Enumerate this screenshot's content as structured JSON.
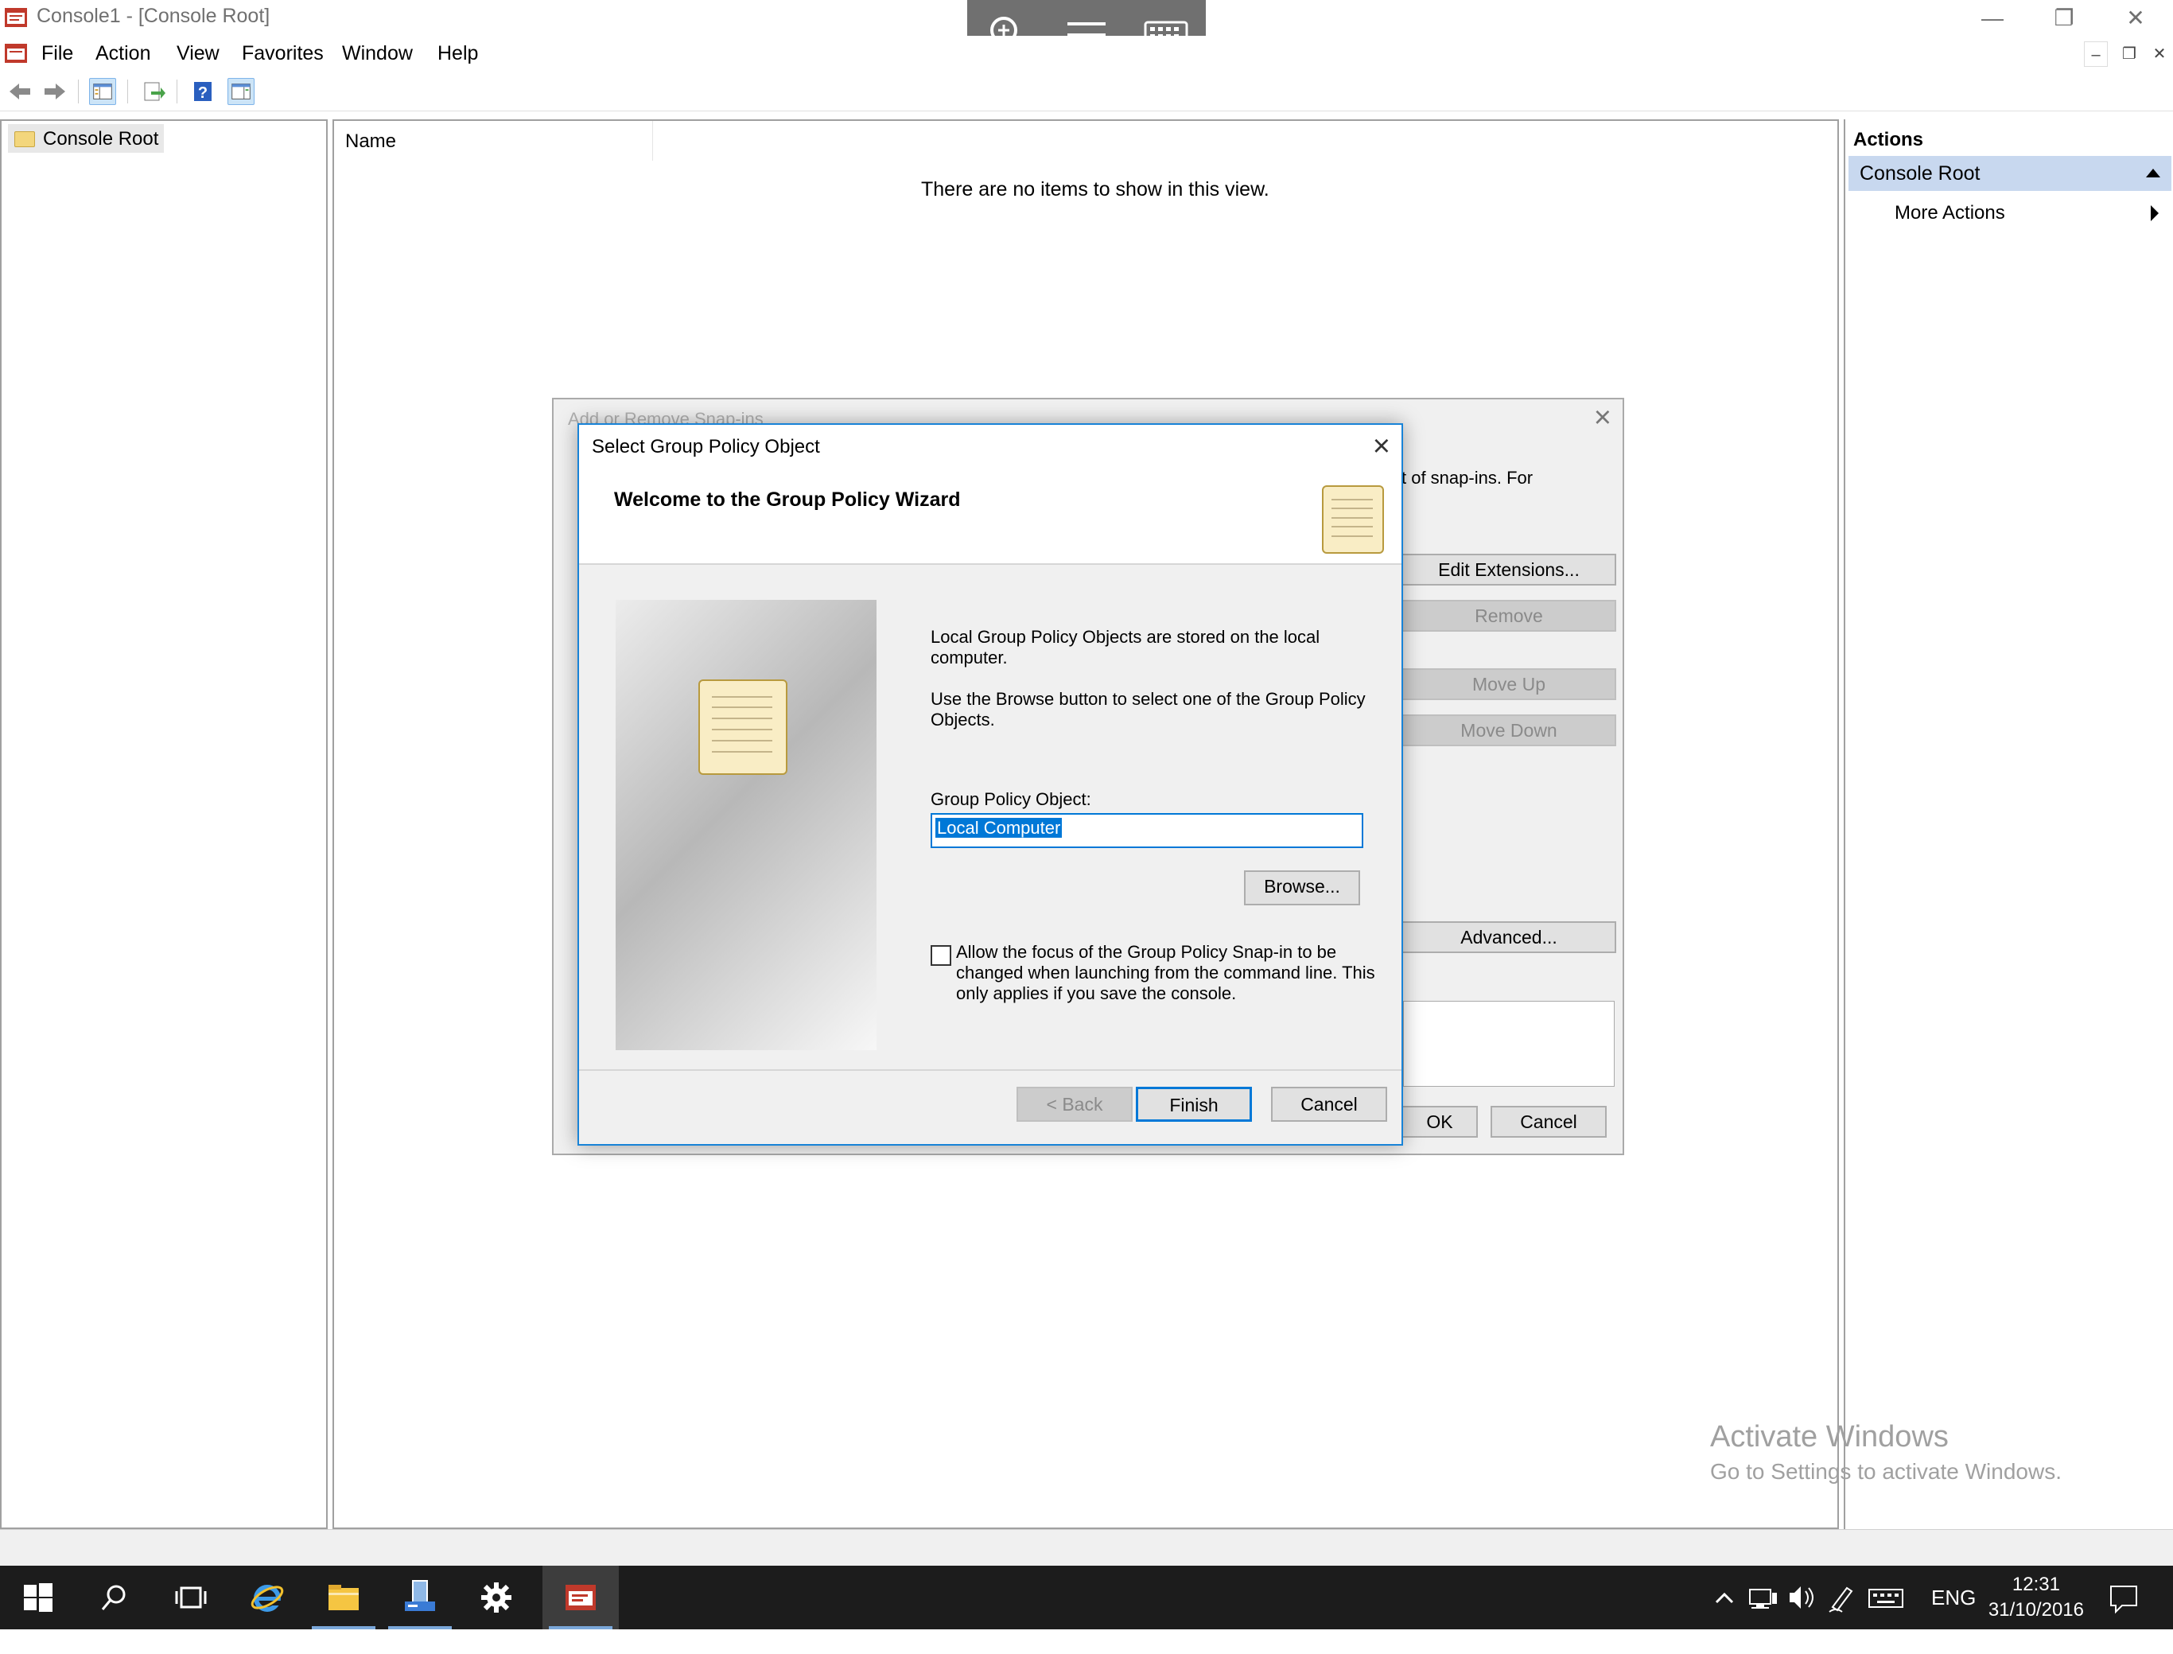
{
  "window": {
    "title": "Console1 - [Console Root]",
    "controls": {
      "minimize": "—",
      "restore": "❐",
      "close": "✕"
    },
    "mdi_controls": {
      "minimize": "–",
      "restore": "❐",
      "close": "✕"
    }
  },
  "menu": [
    "File",
    "Action",
    "View",
    "Favorites",
    "Window",
    "Help"
  ],
  "toolbar": {
    "icons": [
      "back-arrow-icon",
      "forward-arrow-icon",
      "show-hide-tree-icon",
      "export-list-icon",
      "help-icon",
      "show-hide-action-pane-icon"
    ]
  },
  "remote_toolbar": {
    "icons": [
      "zoom-icon",
      "menu-icon",
      "keyboard-icon"
    ]
  },
  "tree": {
    "root_label": "Console Root"
  },
  "center": {
    "column_name": "Name",
    "empty_message": "There are no items to show in this view."
  },
  "actions_pane": {
    "header": "Actions",
    "section": "Console Root",
    "more": "More Actions"
  },
  "snapins_dialog": {
    "title": "Add or Remove Snap-ins",
    "text_fragment": "t of snap-ins. For",
    "buttons": {
      "edit_extensions": "Edit Extensions...",
      "remove": "Remove",
      "move_up": "Move Up",
      "move_down": "Move Down",
      "advanced": "Advanced...",
      "ok": "OK",
      "cancel": "Cancel"
    }
  },
  "wizard": {
    "title": "Select Group Policy Object",
    "heading": "Welcome to the Group Policy Wizard",
    "para1": "Local Group Policy Objects are stored on the local computer.",
    "para2": "Use the Browse button to select one of the Group Policy Objects.",
    "gpo_label": "Group Policy Object:",
    "gpo_value": "Local Computer",
    "browse": "Browse...",
    "checkbox_checked": false,
    "checkbox_text": "Allow the focus of the Group Policy Snap-in to be changed when launching from the command line.  This only applies if you save the console.",
    "buttons": {
      "back": "< Back",
      "finish": "Finish",
      "cancel": "Cancel"
    }
  },
  "watermark": {
    "line1": "Activate Windows",
    "line2": "Go to Settings to activate Windows."
  },
  "taskbar": {
    "apps": [
      "start-icon",
      "search-icon",
      "task-view-icon",
      "internet-explorer-icon",
      "file-explorer-icon",
      "server-manager-icon",
      "settings-icon",
      "mmc-console-icon"
    ],
    "language": "ENG",
    "time": "12:31",
    "date": "31/10/2016"
  }
}
